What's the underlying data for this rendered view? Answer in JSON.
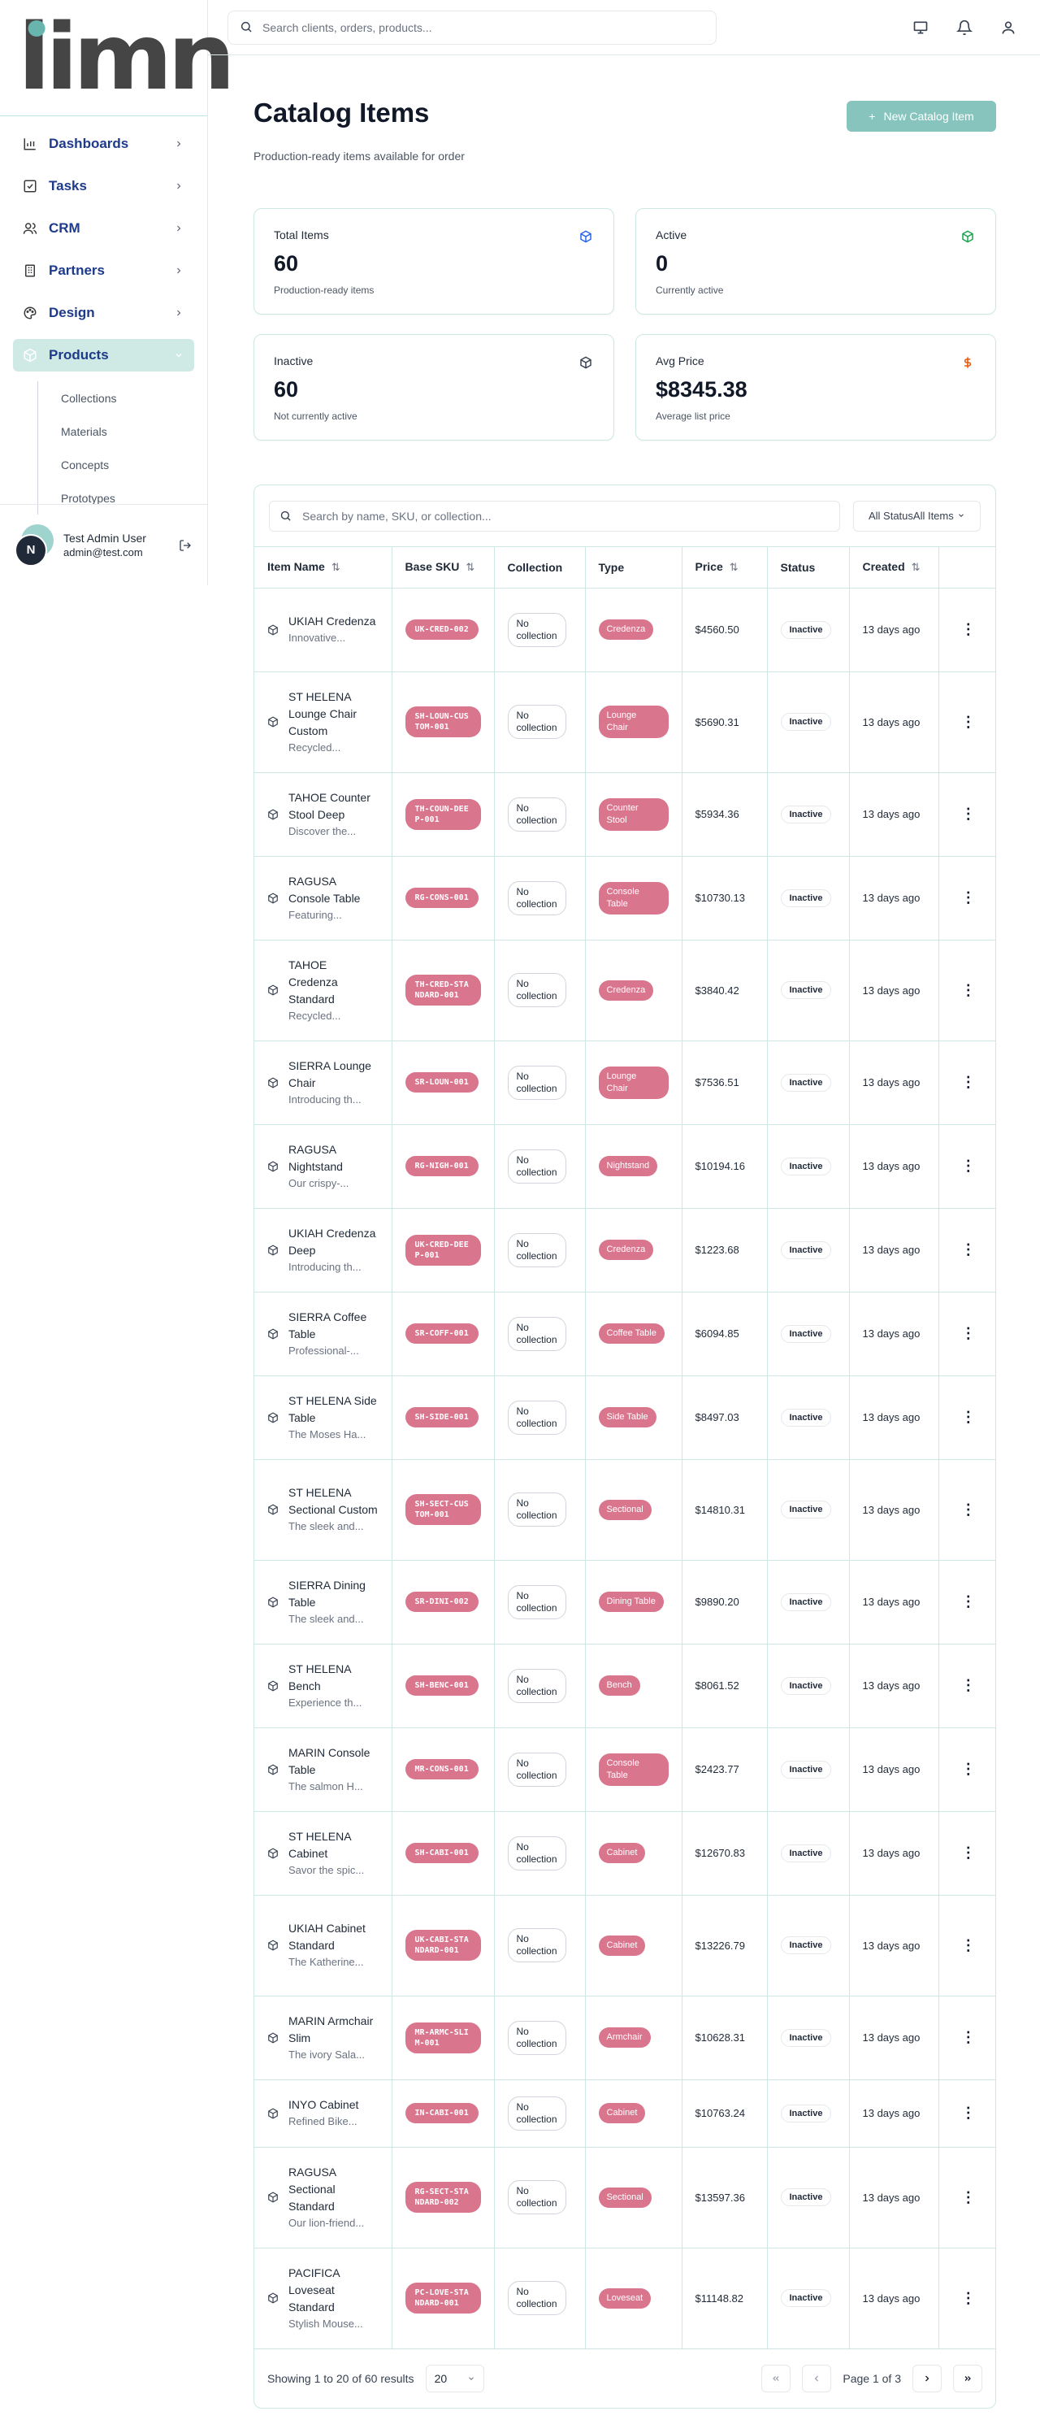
{
  "brand": {
    "logo_text": "limn"
  },
  "search": {
    "placeholder": "Search clients, orders, products..."
  },
  "sidebar": {
    "items": [
      {
        "label": "Dashboards",
        "icon": "bar-chart-icon"
      },
      {
        "label": "Tasks",
        "icon": "checkbox-icon"
      },
      {
        "label": "CRM",
        "icon": "users-icon"
      },
      {
        "label": "Partners",
        "icon": "building-icon"
      },
      {
        "label": "Design",
        "icon": "palette-icon"
      },
      {
        "label": "Products",
        "icon": "package-icon"
      }
    ],
    "subitems": [
      "Collections",
      "Materials",
      "Concepts",
      "Prototypes"
    ]
  },
  "user": {
    "name": "Test Admin User",
    "email": "admin@test.com",
    "initial": "N"
  },
  "page": {
    "title": "Catalog Items",
    "subtitle": "Production-ready items available for order",
    "new_button": "New Catalog Item"
  },
  "stats": [
    {
      "label": "Total Items",
      "value": "60",
      "desc": "Production-ready items",
      "icon": "package-icon",
      "color": "#2563eb"
    },
    {
      "label": "Active",
      "value": "0",
      "desc": "Currently active",
      "icon": "package-icon",
      "color": "#16a34a"
    },
    {
      "label": "Inactive",
      "value": "60",
      "desc": "Not currently active",
      "icon": "package-icon",
      "color": "#374151"
    },
    {
      "label": "Avg Price",
      "value": "$8345.38",
      "desc": "Average list price",
      "icon": "dollar-icon",
      "color": "#ea580c"
    }
  ],
  "table": {
    "search_placeholder": "Search by name, SKU, or collection...",
    "status_filter": "All StatusAll Items",
    "columns": [
      "Item Name",
      "Base SKU",
      "Collection",
      "Type",
      "Price",
      "Status",
      "Created"
    ],
    "rows": [
      {
        "name": "UKIAH Credenza",
        "desc": "Innovative...",
        "sku": "UK-CRED-002",
        "collection": "No collection",
        "type": "Credenza",
        "price": "$4560.50",
        "status": "Inactive",
        "created": "13 days ago"
      },
      {
        "name": "ST HELENA Lounge Chair Custom",
        "desc": "Recycled...",
        "sku": "SH-LOUN-CUSTOM-001",
        "collection": "No collection",
        "type": "Lounge Chair",
        "price": "$5690.31",
        "status": "Inactive",
        "created": "13 days ago"
      },
      {
        "name": "TAHOE Counter Stool Deep",
        "desc": "Discover the...",
        "sku": "TH-COUN-DEEP-001",
        "collection": "No collection",
        "type": "Counter Stool",
        "price": "$5934.36",
        "status": "Inactive",
        "created": "13 days ago"
      },
      {
        "name": "RAGUSA Console Table",
        "desc": "Featuring...",
        "sku": "RG-CONS-001",
        "collection": "No collection",
        "type": "Console Table",
        "price": "$10730.13",
        "status": "Inactive",
        "created": "13 days ago"
      },
      {
        "name": "TAHOE Credenza Standard",
        "desc": "Recycled...",
        "sku": "TH-CRED-STANDARD-001",
        "collection": "No collection",
        "type": "Credenza",
        "price": "$3840.42",
        "status": "Inactive",
        "created": "13 days ago"
      },
      {
        "name": "SIERRA Lounge Chair",
        "desc": "Introducing th...",
        "sku": "SR-LOUN-001",
        "collection": "No collection",
        "type": "Lounge Chair",
        "price": "$7536.51",
        "status": "Inactive",
        "created": "13 days ago"
      },
      {
        "name": "RAGUSA Nightstand",
        "desc": "Our crispy-...",
        "sku": "RG-NIGH-001",
        "collection": "No collection",
        "type": "Nightstand",
        "price": "$10194.16",
        "status": "Inactive",
        "created": "13 days ago"
      },
      {
        "name": "UKIAH Credenza Deep",
        "desc": "Introducing th...",
        "sku": "UK-CRED-DEEP-001",
        "collection": "No collection",
        "type": "Credenza",
        "price": "$1223.68",
        "status": "Inactive",
        "created": "13 days ago"
      },
      {
        "name": "SIERRA Coffee Table",
        "desc": "Professional-...",
        "sku": "SR-COFF-001",
        "collection": "No collection",
        "type": "Coffee Table",
        "price": "$6094.85",
        "status": "Inactive",
        "created": "13 days ago"
      },
      {
        "name": "ST HELENA Side Table",
        "desc": "The Moses Ha...",
        "sku": "SH-SIDE-001",
        "collection": "No collection",
        "type": "Side Table",
        "price": "$8497.03",
        "status": "Inactive",
        "created": "13 days ago"
      },
      {
        "name": "ST HELENA Sectional Custom",
        "desc": "The sleek and...",
        "sku": "SH-SECT-CUSTOM-001",
        "collection": "No collection",
        "type": "Sectional",
        "price": "$14810.31",
        "status": "Inactive",
        "created": "13 days ago"
      },
      {
        "name": "SIERRA Dining Table",
        "desc": "The sleek and...",
        "sku": "SR-DINI-002",
        "collection": "No collection",
        "type": "Dining Table",
        "price": "$9890.20",
        "status": "Inactive",
        "created": "13 days ago"
      },
      {
        "name": "ST HELENA Bench",
        "desc": "Experience th...",
        "sku": "SH-BENC-001",
        "collection": "No collection",
        "type": "Bench",
        "price": "$8061.52",
        "status": "Inactive",
        "created": "13 days ago"
      },
      {
        "name": "MARIN Console Table",
        "desc": "The salmon H...",
        "sku": "MR-CONS-001",
        "collection": "No collection",
        "type": "Console Table",
        "price": "$2423.77",
        "status": "Inactive",
        "created": "13 days ago"
      },
      {
        "name": "ST HELENA Cabinet",
        "desc": "Savor the spic...",
        "sku": "SH-CABI-001",
        "collection": "No collection",
        "type": "Cabinet",
        "price": "$12670.83",
        "status": "Inactive",
        "created": "13 days ago"
      },
      {
        "name": "UKIAH Cabinet Standard",
        "desc": "The Katherine...",
        "sku": "UK-CABI-STANDARD-001",
        "collection": "No collection",
        "type": "Cabinet",
        "price": "$13226.79",
        "status": "Inactive",
        "created": "13 days ago"
      },
      {
        "name": "MARIN Armchair Slim",
        "desc": "The ivory Sala...",
        "sku": "MR-ARMC-SLIM-001",
        "collection": "No collection",
        "type": "Armchair",
        "price": "$10628.31",
        "status": "Inactive",
        "created": "13 days ago"
      },
      {
        "name": "INYO Cabinet",
        "desc": "Refined Bike...",
        "sku": "IN-CABI-001",
        "collection": "No collection",
        "type": "Cabinet",
        "price": "$10763.24",
        "status": "Inactive",
        "created": "13 days ago"
      },
      {
        "name": "RAGUSA Sectional Standard",
        "desc": "Our lion-friend...",
        "sku": "RG-SECT-STANDARD-002",
        "collection": "No collection",
        "type": "Sectional",
        "price": "$13597.36",
        "status": "Inactive",
        "created": "13 days ago"
      },
      {
        "name": "PACIFICA Loveseat Standard",
        "desc": "Stylish Mouse...",
        "sku": "PC-LOVE-STANDARD-001",
        "collection": "No collection",
        "type": "Loveseat",
        "price": "$11148.82",
        "status": "Inactive",
        "created": "13 days ago"
      }
    ]
  },
  "pagination": {
    "info": "Showing 1 to 20 of 60 results",
    "page_size": "20",
    "page_label": "Page 1 of 3"
  },
  "colors": {
    "accent": "#86c4bd",
    "badge": "#d9768d",
    "border": "#cde8e4"
  }
}
